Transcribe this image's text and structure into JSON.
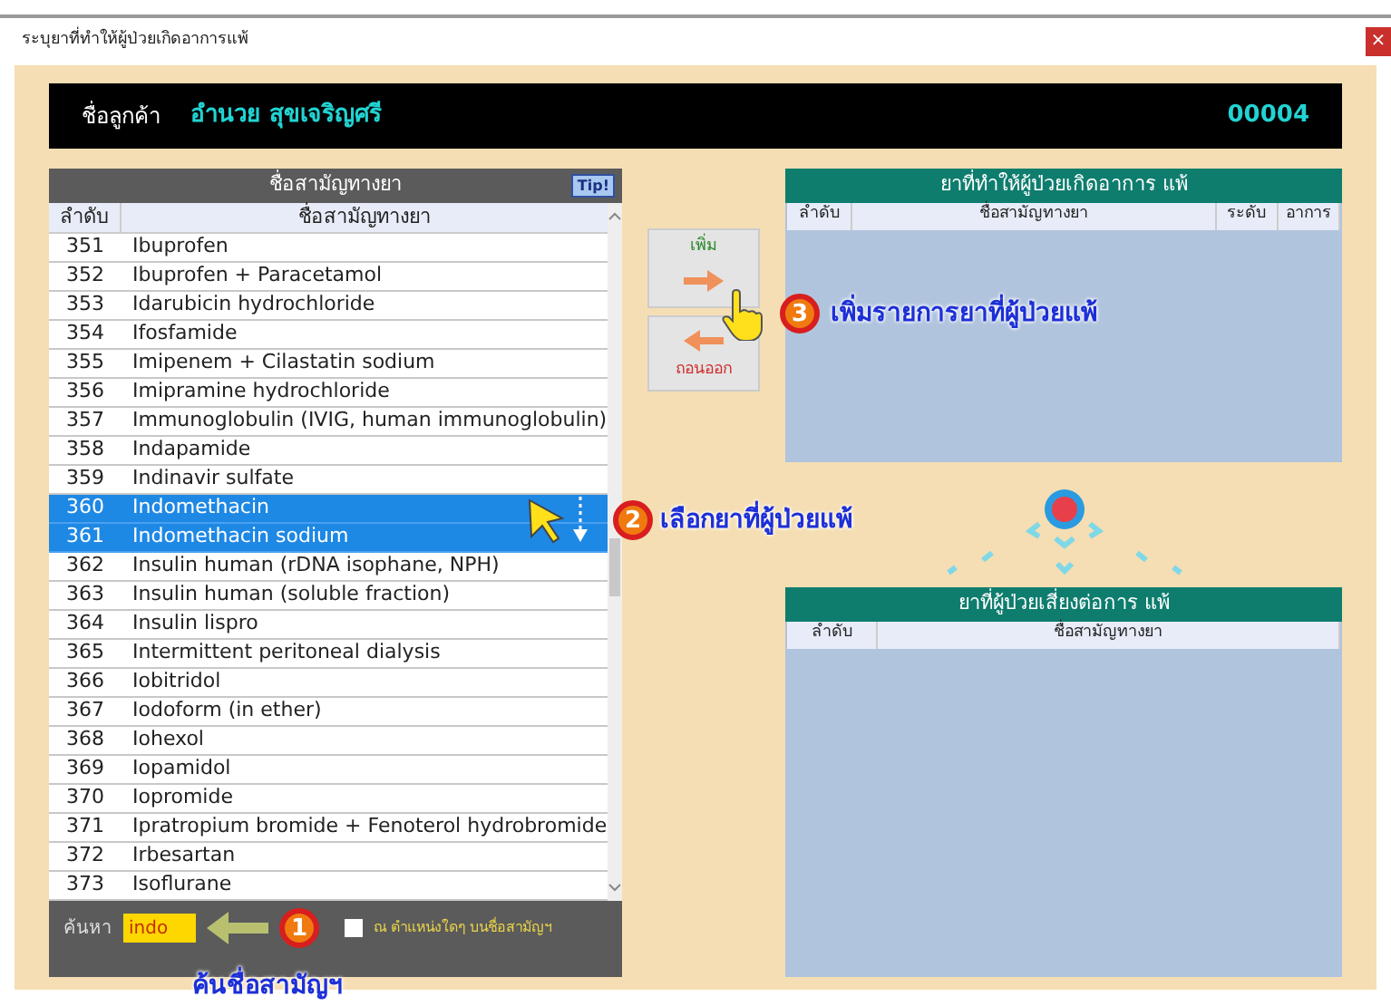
{
  "window": {
    "title": "ระบุยาที่ทำให้ผู้ป่วยเกิดอาการแพ้",
    "close": "×"
  },
  "customer": {
    "label": "ชื่อลูกค้า",
    "name": "อำนวย สุขเจริญศรี",
    "code": "00004"
  },
  "drug_list": {
    "title": "ชื่อสามัญทางยา",
    "tip_button": "Tip!",
    "columns": [
      "ลำดับ",
      "ชื่อสามัญทางยา"
    ],
    "rows": [
      {
        "no": "351",
        "name": "Ibuprofen",
        "selected": false
      },
      {
        "no": "352",
        "name": "Ibuprofen + Paracetamol",
        "selected": false
      },
      {
        "no": "353",
        "name": "Idarubicin hydrochloride",
        "selected": false
      },
      {
        "no": "354",
        "name": "Ifosfamide",
        "selected": false
      },
      {
        "no": "355",
        "name": "Imipenem + Cilastatin sodium",
        "selected": false
      },
      {
        "no": "356",
        "name": "Imipramine hydrochloride",
        "selected": false
      },
      {
        "no": "357",
        "name": "Immunoglobulin (IVIG, human immunoglobulin)",
        "selected": false
      },
      {
        "no": "358",
        "name": "Indapamide",
        "selected": false
      },
      {
        "no": "359",
        "name": "Indinavir sulfate",
        "selected": false
      },
      {
        "no": "360",
        "name": "Indomethacin",
        "selected": true
      },
      {
        "no": "361",
        "name": "Indomethacin sodium",
        "selected": true
      },
      {
        "no": "362",
        "name": "Insulin human (rDNA isophane, NPH)",
        "selected": false
      },
      {
        "no": "363",
        "name": "Insulin human (soluble fraction)",
        "selected": false
      },
      {
        "no": "364",
        "name": "Insulin lispro",
        "selected": false
      },
      {
        "no": "365",
        "name": "Intermittent peritoneal dialysis",
        "selected": false
      },
      {
        "no": "366",
        "name": "Iobitridol",
        "selected": false
      },
      {
        "no": "367",
        "name": "Iodoform (in ether)",
        "selected": false
      },
      {
        "no": "368",
        "name": "Iohexol",
        "selected": false
      },
      {
        "no": "369",
        "name": "Iopamidol",
        "selected": false
      },
      {
        "no": "370",
        "name": "Iopromide",
        "selected": false
      },
      {
        "no": "371",
        "name": "Ipratropium bromide + Fenoterol hydrobromide",
        "selected": false
      },
      {
        "no": "372",
        "name": "Irbesartan",
        "selected": false
      },
      {
        "no": "373",
        "name": "Isoflurane",
        "selected": false
      }
    ]
  },
  "search": {
    "label": "ค้นหา",
    "value": "indo",
    "anywhere": {
      "label": "ณ ตำแหน่งใดๆ บนชื่อสามัญฯ",
      "checked": false
    }
  },
  "buttons": {
    "add": "เพิ่ม",
    "remove": "ถอนออก"
  },
  "allergy_table": {
    "title": "ยาที่ทำให้ผู้ป่วยเกิดอาการ แพ้",
    "columns": [
      "ลำดับ",
      "ชื่อสามัญทางยา",
      "ระดับ",
      "อาการ"
    ]
  },
  "risk_table": {
    "title": "ยาที่ผู้ป่วยเสี่ยงต่อการ แพ้",
    "columns": [
      "ลำดับ",
      "ชื่อสามัญทางยา"
    ]
  },
  "annotations": [
    {
      "number": "1",
      "text": "ค้นชื่อสามัญฯ"
    },
    {
      "number": "2",
      "text": "เลือกยาที่ผู้ป่วยแพ้"
    },
    {
      "number": "3",
      "text": "เพิ่มรายการยาที่ผู้ป่วยแพ้"
    }
  ]
}
